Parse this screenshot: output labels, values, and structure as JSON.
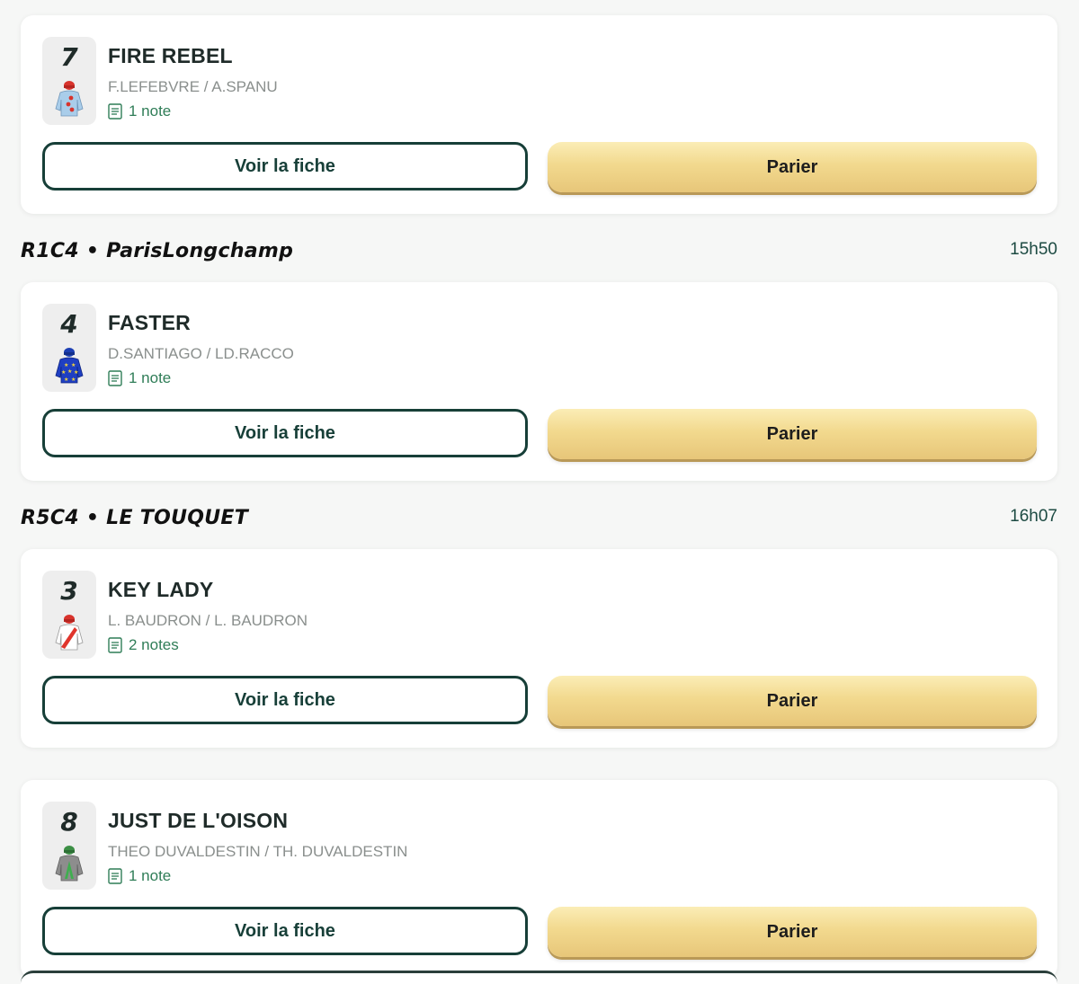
{
  "races": [
    {
      "title": "R1C4 • ParisLongchamp",
      "time": "15h50"
    },
    {
      "title": "R5C4 • LE TOUQUET",
      "time": "16h07"
    }
  ],
  "runners": [
    {
      "number": "7",
      "name": "FIRE REBEL",
      "people": "F.LEFEBVRE / A.SPANU",
      "notes": "1 note",
      "silk": "light-blue-red-dots-silk-icon"
    },
    {
      "number": "4",
      "name": "FASTER",
      "people": "D.SANTIAGO / LD.RACCO",
      "notes": "1 note",
      "silk": "blue-yellow-stars-silk-icon"
    },
    {
      "number": "3",
      "name": "KEY LADY",
      "people": "L. BAUDRON / L. BAUDRON",
      "notes": "2 notes",
      "silk": "white-red-sash-silk-icon"
    },
    {
      "number": "8",
      "name": "JUST DE L'OISON",
      "people": "THEO DUVALDESTIN / TH. DUVALDESTIN",
      "notes": "1 note",
      "silk": "grey-green-chevron-silk-icon"
    }
  ],
  "buttons": {
    "fiche_label": "Voir la fiche",
    "parier_label": "Parier"
  },
  "colors": {
    "accent_green": "#173f38",
    "note_green": "#2f7d57",
    "bet_gold": "#f2d98e"
  }
}
